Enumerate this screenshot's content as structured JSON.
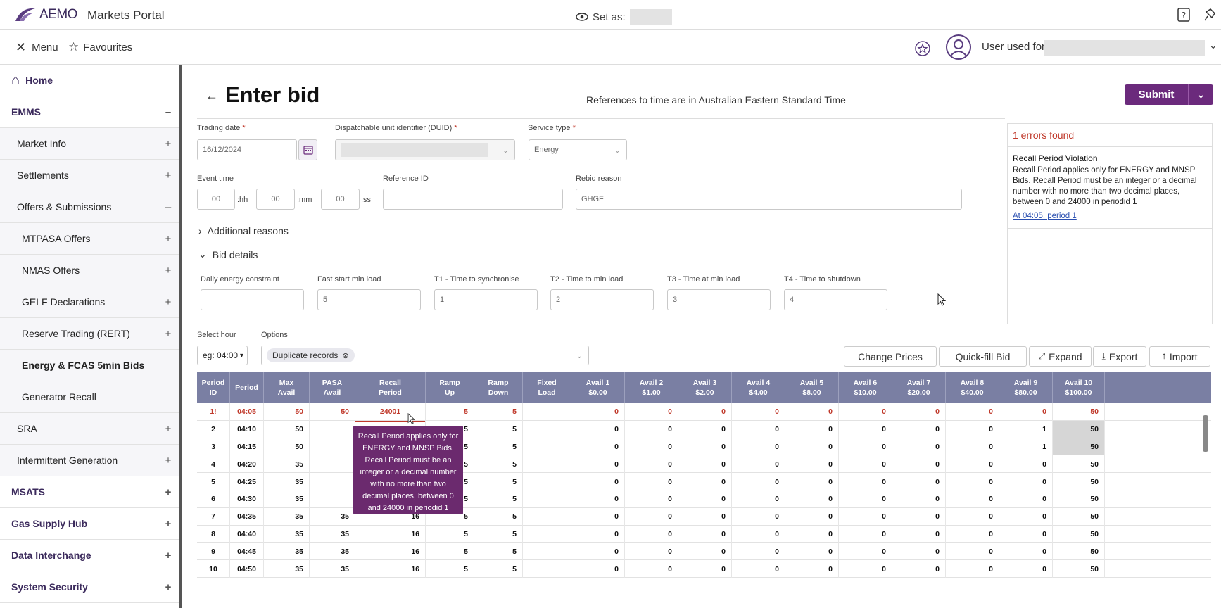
{
  "header": {
    "logo_text": "AEMO",
    "portal": "Markets Portal",
    "set_as": "Set as:"
  },
  "subheader": {
    "menu": "Menu",
    "favourites": "Favourites",
    "user": "User used for"
  },
  "sidebar": {
    "items": [
      {
        "label": "Home",
        "level": "top",
        "sign": ""
      },
      {
        "label": "EMMS",
        "level": "top",
        "sign": "–"
      },
      {
        "label": "Market Info",
        "level": "l1",
        "sign": "+"
      },
      {
        "label": "Settlements",
        "level": "l1",
        "sign": "+"
      },
      {
        "label": "Offers & Submissions",
        "level": "l1",
        "sign": "–"
      },
      {
        "label": "MTPASA Offers",
        "level": "l2",
        "sign": "+"
      },
      {
        "label": "NMAS Offers",
        "level": "l2",
        "sign": "+"
      },
      {
        "label": "GELF Declarations",
        "level": "l2",
        "sign": "+"
      },
      {
        "label": "Reserve Trading (RERT)",
        "level": "l2",
        "sign": "+"
      },
      {
        "label": "Energy & FCAS 5min Bids",
        "level": "l2",
        "sign": ""
      },
      {
        "label": "Generator Recall",
        "level": "l2",
        "sign": ""
      },
      {
        "label": "SRA",
        "level": "l1",
        "sign": "+"
      },
      {
        "label": "Intermittent Generation",
        "level": "l1",
        "sign": "+"
      },
      {
        "label": "MSATS",
        "level": "top",
        "sign": "+"
      },
      {
        "label": "Gas Supply Hub",
        "level": "top",
        "sign": "+"
      },
      {
        "label": "Data Interchange",
        "level": "top",
        "sign": "+"
      },
      {
        "label": "System Security",
        "level": "top",
        "sign": "+"
      }
    ]
  },
  "page": {
    "title": "Enter bid",
    "tz_note": "References to time are in Australian Eastern Standard Time",
    "submit": "Submit"
  },
  "form": {
    "trading_date_label": "Trading date",
    "trading_date": "16/12/2024",
    "duid_label": "Dispatchable unit identifier (DUID)",
    "duid_value": "",
    "service_type_label": "Service type",
    "service_type": "Energy",
    "event_time_label": "Event time",
    "hh_placeholder": "00",
    "mm_placeholder": "00",
    "ss_placeholder": "00",
    "hh": ":hh",
    "mm": ":mm",
    "ss": ":ss",
    "reference_id_label": "Reference ID",
    "reference_id": "",
    "rebid_reason_label": "Rebid reason",
    "rebid_reason": "GHGF",
    "additional_reasons": "Additional reasons",
    "bid_details": "Bid details",
    "daily_energy_label": "Daily energy constraint",
    "daily_energy": "",
    "fast_start_label": "Fast start min load",
    "fast_start": "5",
    "t1_label": "T1 - Time to synchronise",
    "t1": "1",
    "t2_label": "T2 - Time to min load",
    "t2": "2",
    "t3_label": "T3 - Time at min load",
    "t3": "3",
    "t4_label": "T4 - Time to shutdown",
    "t4": "4",
    "select_hour_label": "Select hour",
    "select_hour": "eg: 04:00",
    "options_label": "Options",
    "options_chip": "Duplicate records"
  },
  "errors": {
    "title": "1 errors found",
    "heading": "Recall Period Violation",
    "body": "Recall Period applies only for ENERGY and MNSP Bids. Recall Period must be an integer or a decimal number with no more than two decimal places, between 0 and 24000 in periodid 1",
    "link": "At 04:05, period 1"
  },
  "toolbar": {
    "change_prices": "Change Prices",
    "quick_fill": "Quick-fill Bid",
    "expand": "Expand",
    "export": "Export",
    "import": "Import"
  },
  "table": {
    "headers": [
      "Period\nID",
      "Period",
      "Max\nAvail",
      "PASA\nAvail",
      "Recall\nPeriod",
      "Ramp\nUp",
      "Ramp\nDown",
      "Fixed\nLoad",
      "Avail 1\n$0.00",
      "Avail 2\n$1.00",
      "Avail 3\n$2.00",
      "Avail 4\n$4.00",
      "Avail 5\n$8.00",
      "Avail 6\n$10.00",
      "Avail 7\n$20.00",
      "Avail 8\n$40.00",
      "Avail 9\n$80.00",
      "Avail 10\n$100.00"
    ],
    "rows": [
      [
        "1!",
        "04:05",
        "50",
        "50",
        "24001",
        "5",
        "5",
        "",
        "0",
        "0",
        "0",
        "0",
        "0",
        "0",
        "0",
        "0",
        "0",
        "50"
      ],
      [
        "2",
        "04:10",
        "50",
        "",
        "",
        "5",
        "5",
        "",
        "0",
        "0",
        "0",
        "0",
        "0",
        "0",
        "0",
        "0",
        "1",
        "50"
      ],
      [
        "3",
        "04:15",
        "50",
        "",
        "",
        "5",
        "5",
        "",
        "0",
        "0",
        "0",
        "0",
        "0",
        "0",
        "0",
        "0",
        "1",
        "50"
      ],
      [
        "4",
        "04:20",
        "35",
        "",
        "",
        "5",
        "5",
        "",
        "0",
        "0",
        "0",
        "0",
        "0",
        "0",
        "0",
        "0",
        "0",
        "50"
      ],
      [
        "5",
        "04:25",
        "35",
        "",
        "",
        "5",
        "5",
        "",
        "0",
        "0",
        "0",
        "0",
        "0",
        "0",
        "0",
        "0",
        "0",
        "50"
      ],
      [
        "6",
        "04:30",
        "35",
        "",
        "",
        "5",
        "5",
        "",
        "0",
        "0",
        "0",
        "0",
        "0",
        "0",
        "0",
        "0",
        "0",
        "50"
      ],
      [
        "7",
        "04:35",
        "35",
        "35",
        "16",
        "5",
        "5",
        "",
        "0",
        "0",
        "0",
        "0",
        "0",
        "0",
        "0",
        "0",
        "0",
        "50"
      ],
      [
        "8",
        "04:40",
        "35",
        "35",
        "16",
        "5",
        "5",
        "",
        "0",
        "0",
        "0",
        "0",
        "0",
        "0",
        "0",
        "0",
        "0",
        "50"
      ],
      [
        "9",
        "04:45",
        "35",
        "35",
        "16",
        "5",
        "5",
        "",
        "0",
        "0",
        "0",
        "0",
        "0",
        "0",
        "0",
        "0",
        "0",
        "50"
      ],
      [
        "10",
        "04:50",
        "35",
        "35",
        "16",
        "5",
        "5",
        "",
        "0",
        "0",
        "0",
        "0",
        "0",
        "0",
        "0",
        "0",
        "0",
        "50"
      ]
    ]
  },
  "tooltip": "Recall Period applies only for ENERGY and MNSP Bids. Recall Period must be an integer or a decimal number with no more than two decimal places, between 0 and 24000 in periodid 1",
  "colors": {
    "brand": "#6b2a7c",
    "header_row": "#7a7fa3",
    "error": "#c0392b"
  }
}
